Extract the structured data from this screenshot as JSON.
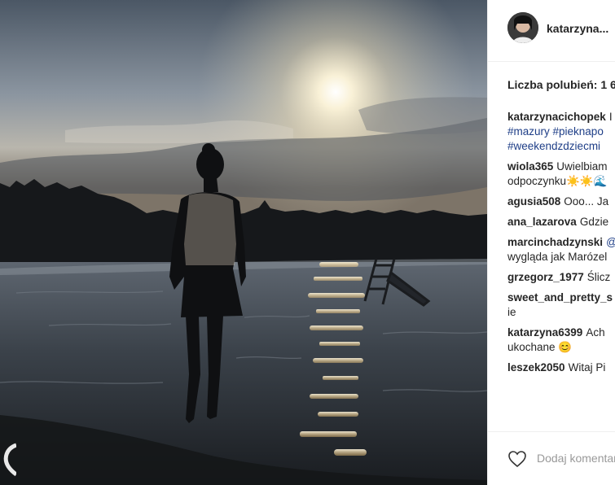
{
  "post": {
    "username": "katarzyna...",
    "likes_text": "Liczba polubień: 1 6",
    "comments": [
      {
        "user": "katarzynacichopek",
        "text": "I",
        "tags": [
          "#mazury #pieknapo",
          "#weekendzdziecmi"
        ]
      },
      {
        "user": "wiola365",
        "text": "Uwielbiam",
        "line2": "odpoczynku☀️☀️🌊"
      },
      {
        "user": "agusia508",
        "text": "Ooo... Ja"
      },
      {
        "user": "ana_lazarova",
        "text": "Gdzie"
      },
      {
        "user": "marcinchadzynski",
        "text": "@",
        "line2": "wygląda jak Marózel"
      },
      {
        "user": "grzegorz_1977",
        "text": "Ślicz"
      },
      {
        "user": "sweet_and_pretty_s",
        "text": "",
        "line2": "ie"
      },
      {
        "user": "katarzyna6399",
        "text": "Ach",
        "line2": "ukochane 😊"
      },
      {
        "user": "leszek2050",
        "text": "Witaj Pi"
      }
    ],
    "add_comment_placeholder": "Dodaj komentarz"
  },
  "icons": {
    "heart": "heart-outline-icon",
    "avatar": "profile-avatar"
  },
  "colors": {
    "text": "#262626",
    "hashtag": "#1e3e87",
    "muted": "#999999",
    "divider": "#efefef"
  }
}
